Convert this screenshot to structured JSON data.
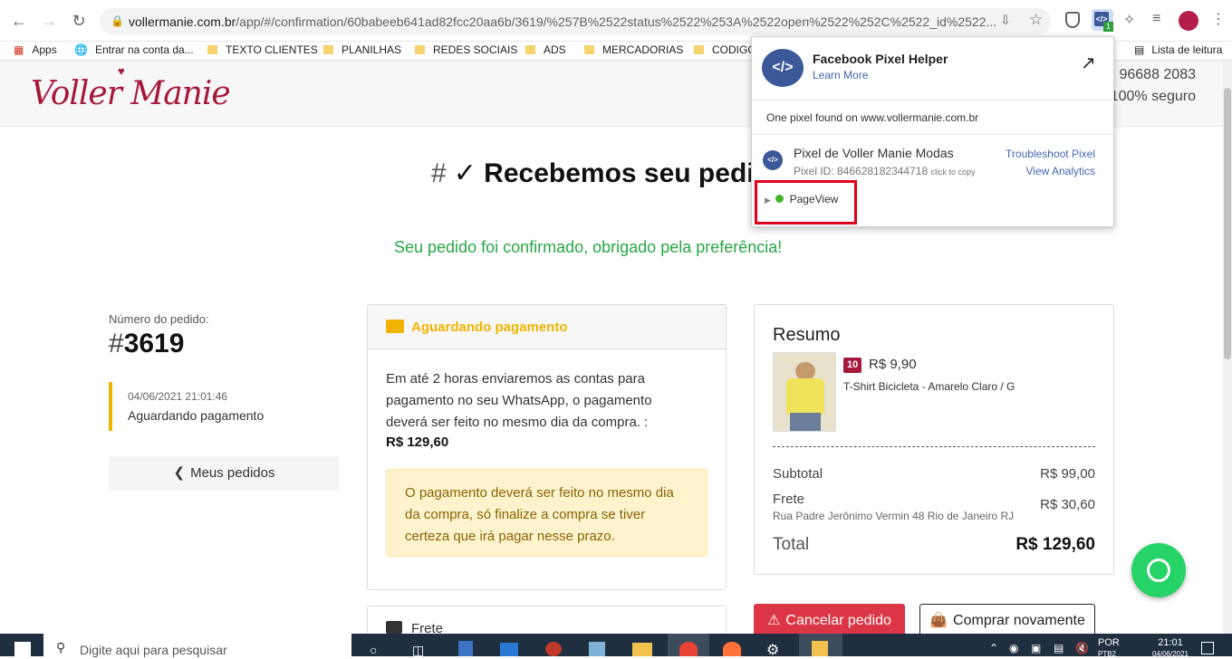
{
  "browser": {
    "url_host": "vollermanie.com.br",
    "url_path": "/app/#/confirmation/60babeeb641ad82fcc20aa6b/3619/%257B%2522status%2522%253A%2522open%2522%252C%2522_id%2522...",
    "extension_badge": "1",
    "bookmarks": [
      "Apps",
      "Entrar na conta da...",
      "TEXTO CLIENTES",
      "PLANILHAS",
      "REDES SOCIAIS",
      "ADS",
      "MERCADORIAS",
      "CODIGO"
    ],
    "reading_list": "Lista de leitura"
  },
  "site": {
    "logo_text": "Voller Manie",
    "phone": "96688 2083",
    "secure": "100% seguro",
    "page_title_hash": "#",
    "page_title": "✓ Recebemos seu pedido",
    "confirmation": "Seu pedido foi confirmado, obrigado pela preferência!"
  },
  "order": {
    "number_label": "Número do pedido:",
    "number_prefix": "#",
    "number": "3619",
    "status_date": "04/06/2021 21:01:46",
    "status_text": "Aguardando pagamento",
    "my_orders": "Meus pedidos"
  },
  "payment": {
    "header": "Aguardando pagamento",
    "text": "Em até 2 horas enviaremos as contas para pagamento no seu WhatsApp, o pagamento deverá ser feito no mesmo dia da compra. :",
    "amount": "R$ 129,60",
    "warning": "O pagamento deverá ser feito no mesmo dia da compra, só finalize a compra se tiver certeza que irá pagar nesse prazo.",
    "shipping_header": "Frete"
  },
  "summary": {
    "title": "Resumo",
    "item_qty": "10",
    "item_price": "R$ 9,90",
    "item_name": "T-Shirt Bicicleta - Amarelo Claro / G",
    "subtotal_label": "Subtotal",
    "subtotal": "R$ 99,00",
    "shipping_label": "Frete",
    "shipping_address": "Rua Padre Jerônimo Vermin 48 Rio de Janeiro RJ",
    "shipping": "R$ 30,60",
    "total_label": "Total",
    "total": "R$ 129,60"
  },
  "actions": {
    "cancel": "Cancelar pedido",
    "buy_again": "Comprar novamente"
  },
  "pixel_helper": {
    "title": "Facebook Pixel Helper",
    "learn_more": "Learn More",
    "found": "One pixel found on www.vollermanie.com.br",
    "pixel_name": "Pixel de Voller Manie Modas",
    "pixel_id": "Pixel ID: 846628182344718",
    "click_copy": "click to copy",
    "troubleshoot": "Troubleshoot Pixel",
    "analytics": "View Analytics",
    "event": "PageView"
  },
  "taskbar": {
    "search": "Digite aqui para pesquisar",
    "lang": "POR",
    "lang2": "PTB2",
    "time": "21:01",
    "date": "04/06/2021"
  },
  "colors": {
    "brand": "#a6193c",
    "warning": "#f0b400",
    "green": "#28a745",
    "danger": "#dc3545",
    "fb": "#3b5998"
  }
}
